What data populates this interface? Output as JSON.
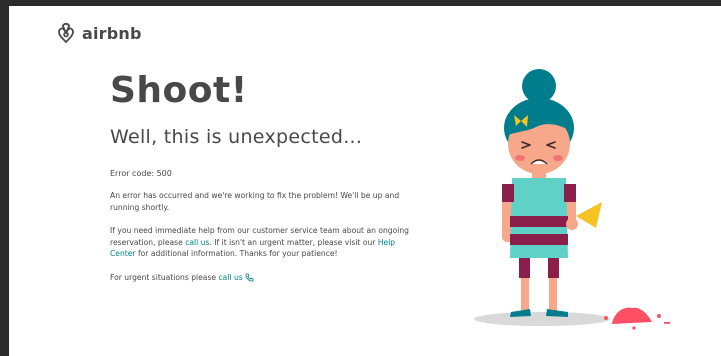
{
  "brand": {
    "name": "airbnb"
  },
  "colors": {
    "link": "#008489",
    "text": "#484848",
    "accent": "#ff5a5f"
  },
  "content": {
    "heading": "Shoot!",
    "subheading": "Well, this is unexpected...",
    "error_code": "Error code: 500",
    "p1": "An error has occurred and we're working to fix the problem! We'll be up and running shortly.",
    "p2_part1": "If you need immediate help from our customer service team about an ongoing reservation, please ",
    "p2_link1": "call us",
    "p2_part2": ". If it isn't an urgent matter, please visit our ",
    "p2_link2": "Help Center",
    "p2_part3": " for additional information. Thanks for your patience!",
    "p3_part1": "For urgent situations please ",
    "p3_link": "call us"
  },
  "icons": {
    "logo": "airbnb-logo-icon",
    "phone": "phone-icon",
    "illustration": "girl-dropped-ice-cream-illustration"
  }
}
